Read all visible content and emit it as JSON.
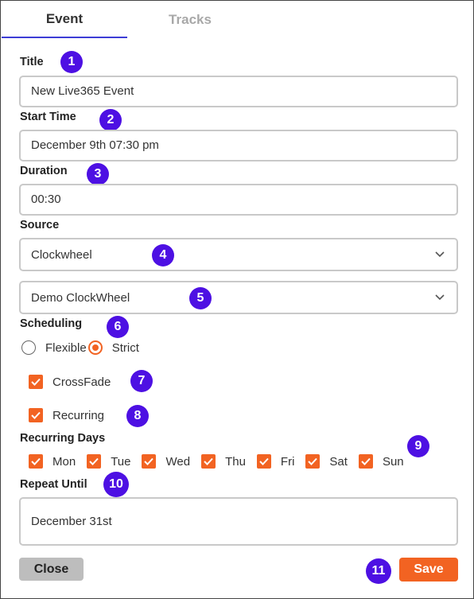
{
  "tabs": {
    "event": "Event",
    "tracks": "Tracks"
  },
  "form": {
    "title_label": "Title",
    "title_value": "New Live365 Event",
    "start_label": "Start Time",
    "start_value": "December 9th 07:30 pm",
    "duration_label": "Duration",
    "duration_value": "00:30",
    "source_label": "Source",
    "source_type": "Clockwheel",
    "source_item": "Demo ClockWheel",
    "scheduling_label": "Scheduling",
    "scheduling_options": [
      "Flexible",
      "Strict"
    ],
    "scheduling_selected": "Strict",
    "crossfade_label": "CrossFade",
    "crossfade_checked": true,
    "recurring_label": "Recurring",
    "recurring_checked": true,
    "recurring_days_label": "Recurring Days",
    "days": [
      "Mon",
      "Tue",
      "Wed",
      "Thu",
      "Fri",
      "Sat",
      "Sun"
    ],
    "repeat_label": "Repeat Until",
    "repeat_value": "December 31st"
  },
  "buttons": {
    "close": "Close",
    "save": "Save"
  },
  "badges": [
    "1",
    "2",
    "3",
    "4",
    "5",
    "6",
    "7",
    "8",
    "9",
    "10",
    "11"
  ],
  "colors": {
    "accent": "#f26322",
    "badge": "#4d10e3",
    "tab_underline": "#3d3dd6"
  },
  "icons": {
    "dropdown": "chevron-down-icon",
    "checkbox": "check-icon"
  }
}
